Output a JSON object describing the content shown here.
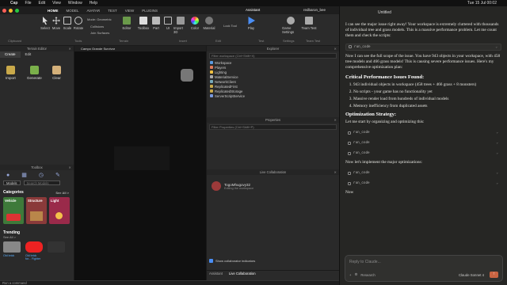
{
  "menubar": {
    "app": "Cap",
    "items": [
      "File",
      "Edit",
      "View",
      "Window",
      "Help"
    ],
    "clock": "Tue 15 Jul 00:02"
  },
  "studio": {
    "ribbon_tabs": [
      "HOME",
      "MODEL",
      "AVATAR",
      "TEST",
      "VIEW",
      "PLUGINS"
    ],
    "window_title": "Campo Grande Survivor - Roblox Studio",
    "assistant": "Assistant",
    "user": "redbaron_bee",
    "tools": [
      "Select",
      "Move",
      "Scale",
      "Rotate",
      "Editor",
      "Toolbox",
      "Part",
      "UI",
      "Import 3D",
      "Color",
      "Material",
      "Play",
      "Game Settings",
      "Team Test"
    ],
    "mode_label": "Mode: Geometric",
    "collisions": "Collisions",
    "join_surfaces": "Join Surfaces",
    "lock_label": "Lock Tool",
    "group_labels": [
      "Clipboard",
      "Tools",
      "Terrain",
      "Insert",
      "Edit",
      "Test",
      "Settings",
      "Team Test"
    ],
    "terrain_editor": {
      "title": "Terrain Editor",
      "tabs": [
        "Create",
        "Edit"
      ],
      "tools": [
        "Import",
        "Generate",
        "Clear"
      ]
    },
    "toolbox": {
      "title": "Toolbox",
      "dropdown": "Models",
      "search_placeholder": "Search Models",
      "categories_label": "Categories",
      "see_all": "See All >",
      "categories": [
        "Vehicle",
        "Structure",
        "Light"
      ],
      "trending_label": "Trending",
      "trending_see_all": "See All >",
      "trending": [
        "Old brick",
        "Old brick for... Fighter",
        ""
      ]
    },
    "viewport_tab": "Campo Grande Survivor",
    "explorer": {
      "title": "Explorer",
      "filter": "Filter workspace (Ctrl+Shift+X)",
      "items": [
        "Workspace",
        "Players",
        "Lighting",
        "MaterialService",
        "NetworkClient",
        "ReplicatedFirst",
        "ReplicatedStorage",
        "ServerScriptService"
      ]
    },
    "properties": {
      "title": "Properties",
      "filter": "Filter Properties (Ctrl+Shift+P)"
    },
    "collab": {
      "title": "Live Collaboration",
      "username": "TogoMhugovy32",
      "status": "Editing the workspace",
      "show_indicators": "Show collaborator indicators",
      "bottom_tabs": [
        "Assistant",
        "Live Collaboration"
      ]
    },
    "command_bar": "Run a command"
  },
  "claude": {
    "title": "Untitled",
    "intro": "I can see the major issue right away! Your workspace is extremely cluttered with thousands of individual tree and grass models. This is a massive performance problem. Let me count them and check the scripts:",
    "run_code": "run_code",
    "para2": "Now I can see the full scope of the issue. You have 943 objects in your workspace, with 458 tree models and 466 grass models! This is causing severe performance issues. Here's my comprehensive optimization plan:",
    "h_issues": "Critical Performance Issues Found:",
    "issues": [
      "943 individual objects in workspace (458 trees + 466 grass + 8 monsters)",
      "No scripts - your game has no functionality yet",
      "Massive render load from hundreds of individual models",
      "Memory inefficiency from duplicated assets"
    ],
    "h_strategy": "Optimization Strategy:",
    "strategy_intro": "Let me start by organizing and optimizing this:",
    "para3": "Now let's implement the major optimizations:",
    "now": "Now",
    "placeholder": "Reply to Claude...",
    "research": "Research",
    "model": "Claude Sonnet 4"
  },
  "colors": {
    "accent": "#c96442",
    "studio_blue": "#4a8ef5"
  }
}
